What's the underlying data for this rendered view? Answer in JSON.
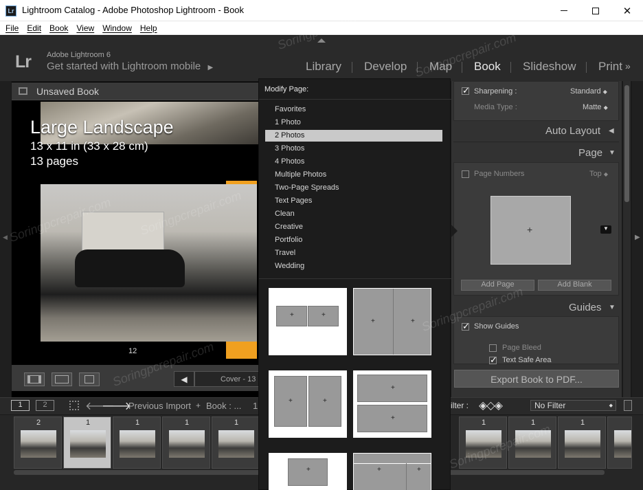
{
  "window": {
    "title": "Lightroom Catalog - Adobe Photoshop Lightroom - Book",
    "app_icon": "Lr",
    "controls": [
      "minimize",
      "maximize",
      "close"
    ]
  },
  "menu": [
    "File",
    "Edit",
    "Book",
    "View",
    "Window",
    "Help"
  ],
  "identity": {
    "logo": "Lr",
    "line1": "Adobe Lightroom 6",
    "line2": "Get started with Lightroom mobile"
  },
  "modules": [
    "Library",
    "Develop",
    "Map",
    "Book",
    "Slideshow",
    "Print"
  ],
  "active_module": "Book",
  "left_panel": {
    "title": "Unsaved Book",
    "book_title": "Large Landscape",
    "book_size": "13 x 11 in (33 x 28 cm)",
    "book_pages": "13 pages",
    "page_number": "12",
    "cover_label": "Cover - 13"
  },
  "popup": {
    "header": "Modify Page:",
    "items": [
      "Favorites",
      "1 Photo",
      "2 Photos",
      "3 Photos",
      "4 Photos",
      "Multiple Photos",
      "Two-Page Spreads",
      "Text Pages",
      "Clean",
      "Creative",
      "Portfolio",
      "Travel",
      "Wedding"
    ],
    "selected": "2 Photos"
  },
  "right_panel": {
    "sharpening_label": "Sharpening :",
    "sharpening_value": "Standard",
    "media_label": "Media Type :",
    "media_value": "Matte",
    "auto_layout": "Auto Layout",
    "page_header": "Page",
    "page_numbers_label": "Page Numbers",
    "page_numbers_pos": "Top",
    "add_page": "Add Page",
    "add_blank": "Add Blank",
    "guides_header": "Guides",
    "show_guides": "Show Guides",
    "page_bleed": "Page Bleed",
    "text_safe_area": "Text Safe Area",
    "export_btn": "Export Book to PDF..."
  },
  "filmstrip": {
    "tab1": "1",
    "tab2": "2",
    "source_label": "Previous Import",
    "book_label": "Book : ...",
    "count": "1",
    "filter_label": "ilter :",
    "filter_value": "No Filter",
    "left_counts": [
      "2",
      "1",
      "1",
      "1",
      "1"
    ],
    "right_counts": [
      "1",
      "1",
      "1"
    ]
  },
  "watermark": "Soringpcrepair.com",
  "colors": {
    "accent_orange": "#f0a020",
    "popup_bg": "#1c1c1c",
    "selected_item": "#c9c9c9"
  }
}
